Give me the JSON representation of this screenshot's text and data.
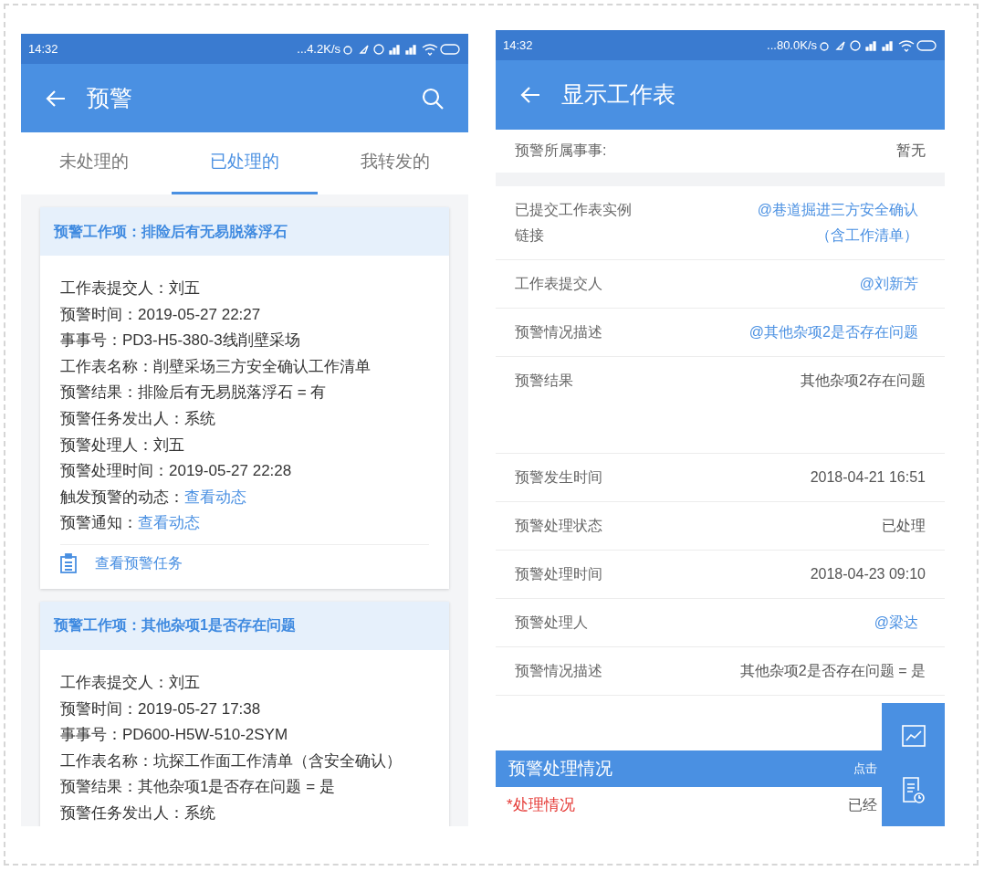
{
  "left_screen": {
    "status_bar": {
      "time": "14:32",
      "speed": "...4.2K/s"
    },
    "title": "预警",
    "tabs": [
      {
        "label": "未处理的",
        "selected": false
      },
      {
        "label": "已处理的",
        "selected": true
      },
      {
        "label": "我转发的",
        "selected": false
      }
    ],
    "cards": [
      {
        "title": "预警工作项：排险后有无易脱落浮石",
        "lines": [
          {
            "label": "工作表提交人：",
            "value": "刘五",
            "kind": "text"
          },
          {
            "label": "预警时间：",
            "value": "2019-05-27 22:27",
            "kind": "text"
          },
          {
            "label": "事事号：",
            "value": "PD3-H5-380-3线削壁采场",
            "kind": "text"
          },
          {
            "label": "工作表名称：",
            "value": "削壁采场三方安全确认工作清单",
            "kind": "text"
          },
          {
            "label": "预警结果：",
            "value": "排险后有无易脱落浮石 = 有",
            "kind": "text"
          },
          {
            "label": "预警任务发出人：",
            "value": "系统",
            "kind": "text"
          },
          {
            "label": "预警处理人：",
            "value": "刘五",
            "kind": "text"
          },
          {
            "label": "预警处理时间：",
            "value": "2019-05-27 22:28",
            "kind": "text"
          },
          {
            "label": "触发预警的动态：",
            "value": "查看动态",
            "kind": "link"
          },
          {
            "label": "预警通知：",
            "value": "查看动态",
            "kind": "link"
          }
        ],
        "action": "查看预警任务"
      },
      {
        "title": "预警工作项：其他杂项1是否存在问题",
        "lines": [
          {
            "label": "工作表提交人：",
            "value": "刘五",
            "kind": "text"
          },
          {
            "label": "预警时间：",
            "value": "2019-05-27 17:38",
            "kind": "text"
          },
          {
            "label": "事事号：",
            "value": "PD600-H5W-510-2SYM",
            "kind": "text"
          },
          {
            "label": "工作表名称：",
            "value": "坑探工作面工作清单（含安全确认）",
            "kind": "text"
          },
          {
            "label": "预警结果：",
            "value": "其他杂项1是否存在问题 = 是",
            "kind": "text"
          },
          {
            "label": "预警任务发出人：",
            "value": "系统",
            "kind": "text"
          }
        ]
      }
    ]
  },
  "right_screen": {
    "status_bar": {
      "time": "14:32",
      "speed": "...80.0K/s"
    },
    "title": "显示工作表",
    "sections": [
      [
        {
          "label": "预警所属事事:",
          "value": "暂无",
          "kind": "text"
        }
      ],
      [
        {
          "label": "已提交工作表实例链接",
          "value": "@巷道掘进三方安全确认（含工作清单）",
          "kind": "link"
        },
        {
          "label": "工作表提交人",
          "value": "@刘新芳",
          "kind": "link"
        },
        {
          "label": "预警情况描述",
          "value": "@其他杂项2是否存在问题",
          "kind": "link"
        },
        {
          "label": "预警结果",
          "value": "其他杂项2存在问题",
          "kind": "tall"
        },
        {
          "label": "预警发生时间",
          "value": "2018-04-21 16:51",
          "kind": "text"
        },
        {
          "label": "预警处理状态",
          "value": "已处理",
          "kind": "text"
        },
        {
          "label": "预警处理时间",
          "value": "2018-04-23 09:10",
          "kind": "text"
        },
        {
          "label": "预警处理人",
          "value": "@梁达",
          "kind": "link"
        },
        {
          "label": "预警情况描述",
          "value": "其他杂项2是否存在问题 = 是",
          "kind": "text"
        }
      ]
    ],
    "panel": {
      "title": "预警处理情况",
      "hint": "点击"
    },
    "field": {
      "label": "*处理情况",
      "required": true,
      "value": "已经"
    }
  }
}
